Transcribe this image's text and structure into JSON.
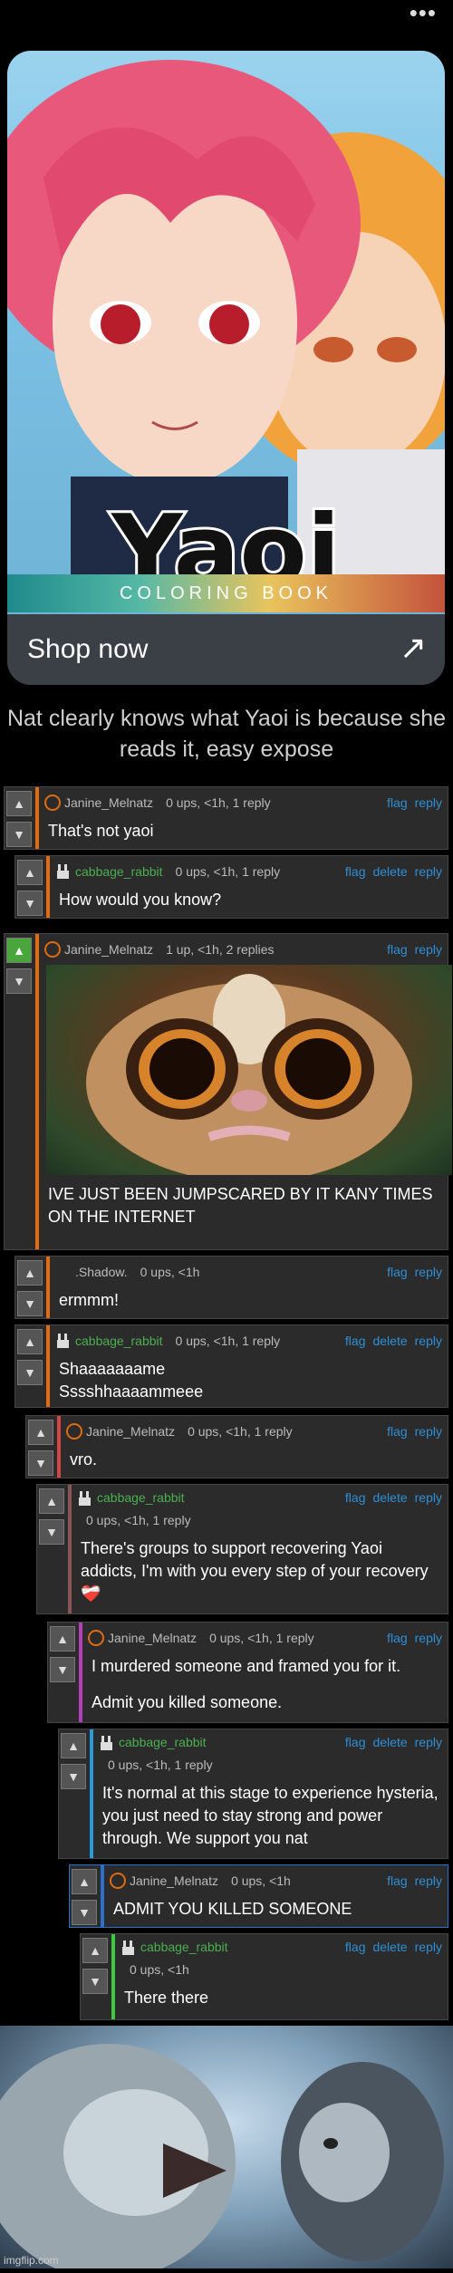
{
  "menu_icon": "more-horizontal-icon",
  "ad": {
    "title": "Yaoi",
    "subtitle": "COLORING BOOK",
    "cta": "Shop now",
    "cta_icon": "arrow-up-right-icon"
  },
  "caption": "Nat clearly knows what Yaoi is because she reads it, easy expose",
  "comments": [
    {
      "user": "Janine_Melnatz",
      "meta": "0 ups, <1h, 1 reply",
      "actions": [
        "flag",
        "reply"
      ],
      "text": "That's not yaoi"
    },
    {
      "user": "cabbage_rabbit",
      "meta": "0 ups, <1h, 1 reply",
      "actions": [
        "flag",
        "delete",
        "reply"
      ],
      "text": "How would you know?"
    },
    {
      "user": "Janine_Melnatz",
      "meta": "1 up, <1h, 2 replies",
      "actions": [
        "flag",
        "reply"
      ],
      "text": "IVE JUST BEEN JUMPSCARED BY IT KANY TIMES ON THE INTERNET",
      "watermark": "imgflip.com"
    },
    {
      "user": ".Shadow.",
      "meta": "0 ups, <1h",
      "actions": [
        "flag",
        "reply"
      ],
      "text": "ermmm!"
    },
    {
      "user": "cabbage_rabbit",
      "meta": "0 ups, <1h, 1 reply",
      "actions": [
        "flag",
        "delete",
        "reply"
      ],
      "text": "Shaaaaaaame Sssshhaaaammeee"
    },
    {
      "user": "Janine_Melnatz",
      "meta": "0 ups, <1h, 1 reply",
      "actions": [
        "flag",
        "reply"
      ],
      "text": "vro."
    },
    {
      "user": "cabbage_rabbit",
      "meta": "0 ups, <1h, 1 reply",
      "actions": [
        "flag",
        "delete",
        "reply"
      ],
      "text": "There's groups to support recovering Yaoi addicts, I'm with you every step of your recovery ❤️‍🩹"
    },
    {
      "user": "Janine_Melnatz",
      "meta": "0 ups, <1h, 1 reply",
      "actions": [
        "flag",
        "reply"
      ],
      "text": "I murdered someone and framed you for it.",
      "text2": "Admit you killed someone."
    },
    {
      "user": "cabbage_rabbit",
      "meta": "0 ups, <1h, 1 reply",
      "actions": [
        "flag",
        "delete",
        "reply"
      ],
      "text": "It's normal at this stage to experience hysteria, you just need to stay strong and power through. We support you nat"
    },
    {
      "user": "Janine_Melnatz",
      "meta": "0 ups, <1h",
      "actions": [
        "flag",
        "reply"
      ],
      "text": "ADMIT YOU KILLED SOMEONE"
    },
    {
      "user": "cabbage_rabbit",
      "meta": "0 ups, <1h",
      "actions": [
        "flag",
        "delete",
        "reply"
      ],
      "text": "There there"
    }
  ],
  "footer_watermark": "imgflip.com"
}
